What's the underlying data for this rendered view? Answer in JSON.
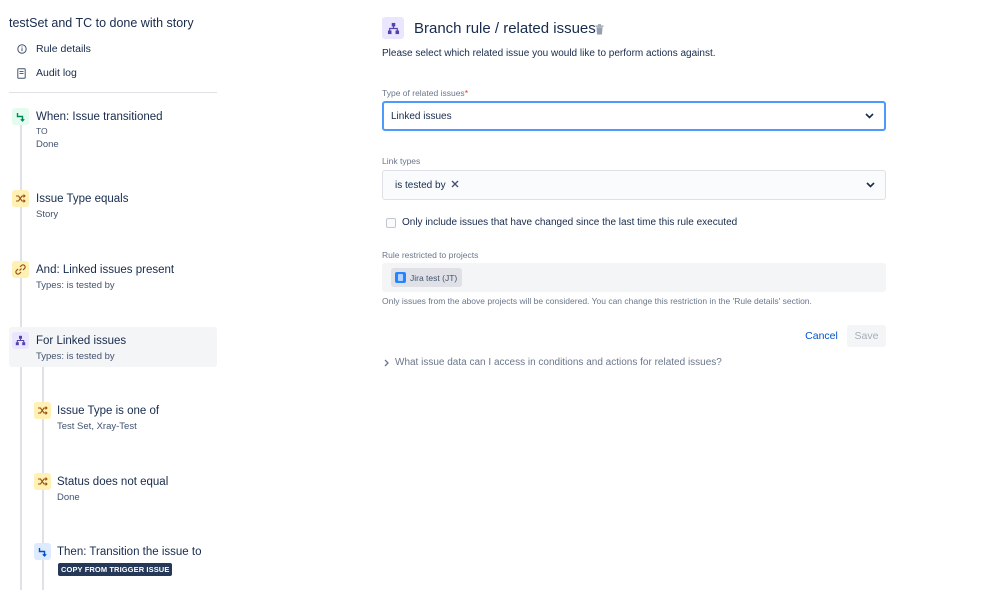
{
  "sidebar": {
    "rule_title": "testSet and TC to done with story",
    "links": {
      "rule_details": "Rule details",
      "audit_log": "Audit log"
    },
    "components": [
      {
        "title": "When: Issue transitioned",
        "sub1": "TO",
        "sub2": "Done",
        "icon": "trigger-icon"
      },
      {
        "title": "Issue Type equals",
        "sub1": "Story",
        "icon": "condition-shuffle-icon"
      },
      {
        "title": "And: Linked issues present",
        "sub1": "Types: is tested by",
        "icon": "link-icon"
      },
      {
        "title": "For Linked issues",
        "sub1": "Types: is tested by",
        "icon": "branch-icon"
      },
      {
        "title": "Issue Type is one of",
        "sub1": "Test Set, Xray-Test",
        "icon": "condition-shuffle-icon"
      },
      {
        "title": "Status does not equal",
        "sub1": "Done",
        "icon": "condition-shuffle-icon"
      },
      {
        "title": "Then: Transition the issue to",
        "tag": "COPY FROM TRIGGER ISSUE",
        "icon": "action-icon"
      }
    ]
  },
  "main": {
    "title": "Branch rule / related issues",
    "description": "Please select which related issue you would like to perform actions against.",
    "related_type": {
      "label": "Type of related issues",
      "required_mark": "*",
      "value": "Linked issues"
    },
    "link_types": {
      "label": "Link types",
      "value": "is tested by"
    },
    "only_changed_label": "Only include issues that have changed since the last time this rule executed",
    "projects": {
      "label": "Rule restricted to projects",
      "chip": "Jira test (JT)",
      "note": "Only issues from the above projects will be considered. You can change this restriction in the 'Rule details' section."
    },
    "buttons": {
      "cancel": "Cancel",
      "save": "Save"
    },
    "help_expander": "What issue data can I access in conditions and actions for related issues?"
  },
  "colors": {
    "primary": "#0052cc",
    "focus_border": "#4c9aff",
    "trigger": "#00875a",
    "condition": "#fff0b3",
    "branch": "#eae6ff",
    "action": "#deebff",
    "tag_bg": "#253858"
  }
}
